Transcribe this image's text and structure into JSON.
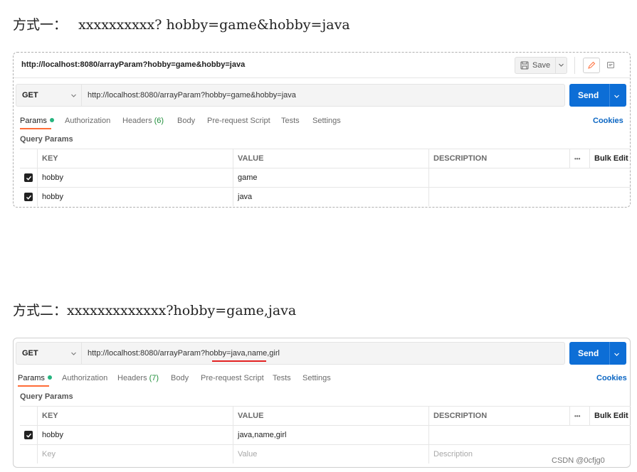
{
  "section1": {
    "heading_prefix": "方式一：",
    "heading_text": "xxxxxxxxxx? hobby=game&hobby=java",
    "title_url": "http://localhost:8080/arrayParam?hobby=game&hobby=java",
    "save_label": "Save",
    "method": "GET",
    "url": "http://localhost:8080/arrayParam?hobby=game&hobby=java",
    "send_label": "Send",
    "tabs": {
      "params": "Params",
      "authorization": "Authorization",
      "headers": "Headers",
      "headers_count": "(6)",
      "body": "Body",
      "prerequest": "Pre-request Script",
      "tests": "Tests",
      "settings": "Settings"
    },
    "cookies": "Cookies",
    "query_params_label": "Query Params",
    "columns": {
      "key": "KEY",
      "value": "VALUE",
      "description": "DESCRIPTION",
      "more": "•••",
      "bulk_edit": "Bulk Edit"
    },
    "rows": [
      {
        "checked": true,
        "key": "hobby",
        "value": "game"
      },
      {
        "checked": true,
        "key": "hobby",
        "value": "java"
      }
    ]
  },
  "section2": {
    "heading_prefix": "方式二：",
    "heading_text": "xxxxxxxxxxxxx?hobby=game,java",
    "method": "GET",
    "url": "http://localhost:8080/arrayParam?hobby=java,name,girl",
    "send_label": "Send",
    "tabs": {
      "params": "Params",
      "authorization": "Authorization",
      "headers": "Headers",
      "headers_count": "(7)",
      "body": "Body",
      "prerequest": "Pre-request Script",
      "tests": "Tests",
      "settings": "Settings"
    },
    "cookies": "Cookies",
    "query_params_label": "Query Params",
    "columns": {
      "key": "KEY",
      "value": "VALUE",
      "description": "DESCRIPTION",
      "more": "•••",
      "bulk_edit": "Bulk Edit"
    },
    "rows": [
      {
        "checked": true,
        "key": "hobby",
        "value": "java,name,girl"
      }
    ],
    "placeholder_row": {
      "key": "Key",
      "value": "Value",
      "description": "Description"
    }
  },
  "watermark": "CSDN @0cfjg0",
  "colors": {
    "send_blue": "#0d6ed6",
    "active_tab_underline": "#ff6c37",
    "highlight_red": "#e32222",
    "params_dot": "#26b47f"
  }
}
